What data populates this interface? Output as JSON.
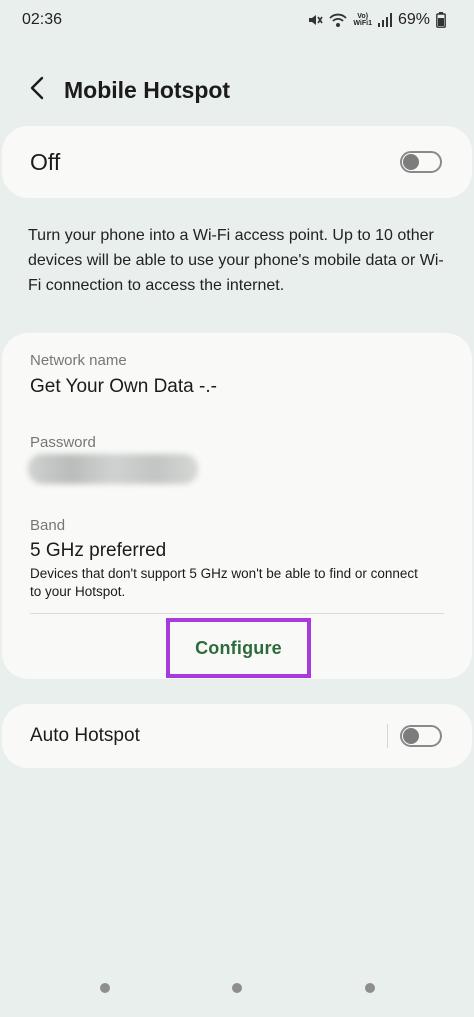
{
  "status_bar": {
    "time": "02:36",
    "volte_top": "Vo)",
    "volte_bottom": "WiFi1",
    "battery": "69%",
    "icons": [
      "mute-icon",
      "wifi-icon",
      "volte-icon",
      "signal-icon",
      "battery-icon"
    ]
  },
  "header": {
    "title": "Mobile Hotspot",
    "back_icon": "chevron-left-icon"
  },
  "hotspot_toggle": {
    "label": "Off",
    "enabled": false
  },
  "description": "Turn your phone into a Wi-Fi access point. Up to 10 other devices will be able to use your phone's mobile data or Wi-Fi connection to access the internet.",
  "network": {
    "name_label": "Network name",
    "name_value": "Get Your Own Data -.-",
    "password_label": "Password",
    "band_label": "Band",
    "band_value": "5 GHz preferred",
    "band_note": "Devices that don't support 5 GHz won't be able to find or connect to your Hotspot.",
    "configure_label": "Configure"
  },
  "auto_hotspot": {
    "label": "Auto Hotspot",
    "enabled": false
  },
  "colors": {
    "background": "#e9efec",
    "card": "#f9faf8",
    "accent_green": "#2e6b3c",
    "highlight_purple": "#a73bde"
  }
}
